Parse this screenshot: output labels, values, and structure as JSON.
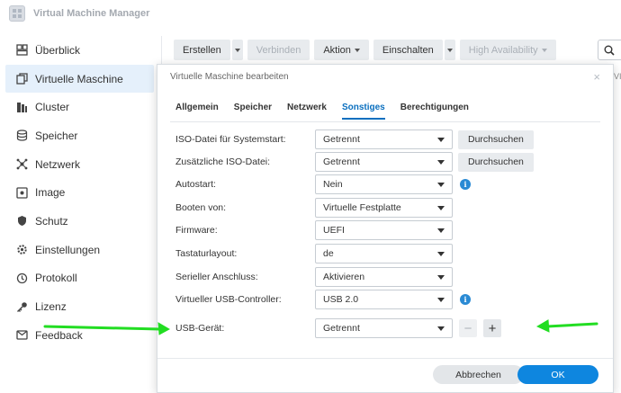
{
  "app": {
    "title": "Virtual Machine Manager"
  },
  "sidebar": {
    "items": [
      {
        "label": "Überblick",
        "icon": "overview-icon"
      },
      {
        "label": "Virtuelle Maschine",
        "icon": "vm-icon",
        "active": true
      },
      {
        "label": "Cluster",
        "icon": "cluster-icon"
      },
      {
        "label": "Speicher",
        "icon": "storage-icon"
      },
      {
        "label": "Netzwerk",
        "icon": "network-icon"
      },
      {
        "label": "Image",
        "icon": "image-icon"
      },
      {
        "label": "Schutz",
        "icon": "shield-icon"
      },
      {
        "label": "Einstellungen",
        "icon": "gear-icon"
      },
      {
        "label": "Protokoll",
        "icon": "log-icon"
      },
      {
        "label": "Lizenz",
        "icon": "key-icon"
      },
      {
        "label": "Feedback",
        "icon": "feedback-icon"
      }
    ]
  },
  "toolbar": {
    "create": "Erstellen",
    "connect": "Verbinden",
    "action": "Aktion",
    "power_on": "Einschalten",
    "high_availability": "High Availability"
  },
  "background": {
    "right_text": "VI"
  },
  "dialog": {
    "title": "Virtuelle Maschine bearbeiten",
    "close": "×",
    "tabs": [
      "Allgemein",
      "Speicher",
      "Netzwerk",
      "Sonstiges",
      "Berechtigungen"
    ],
    "active_tab": "Sonstiges",
    "fields": {
      "iso_boot": {
        "label": "ISO-Datei für Systemstart:",
        "value": "Getrennt"
      },
      "iso_extra": {
        "label": "Zusätzliche ISO-Datei:",
        "value": "Getrennt"
      },
      "autostart": {
        "label": "Autostart:",
        "value": "Nein"
      },
      "boot_from": {
        "label": "Booten von:",
        "value": "Virtuelle Festplatte"
      },
      "firmware": {
        "label": "Firmware:",
        "value": "UEFI"
      },
      "keyboard": {
        "label": "Tastaturlayout:",
        "value": "de"
      },
      "serial": {
        "label": "Serieller Anschluss:",
        "value": "Aktivieren"
      },
      "usb_ctrl": {
        "label": "Virtueller USB-Controller:",
        "value": "USB 2.0"
      },
      "usb_device": {
        "label": "USB-Gerät:",
        "value": "Getrennt"
      }
    },
    "browse_label": "Durchsuchen",
    "info_glyph": "i",
    "minus_glyph": "−",
    "plus_glyph": "+",
    "cancel": "Abbrechen",
    "ok": "OK"
  },
  "colors": {
    "accent": "#0e86df",
    "annotation_arrow": "#22dd22",
    "active_tab": "#0a6fbf"
  }
}
